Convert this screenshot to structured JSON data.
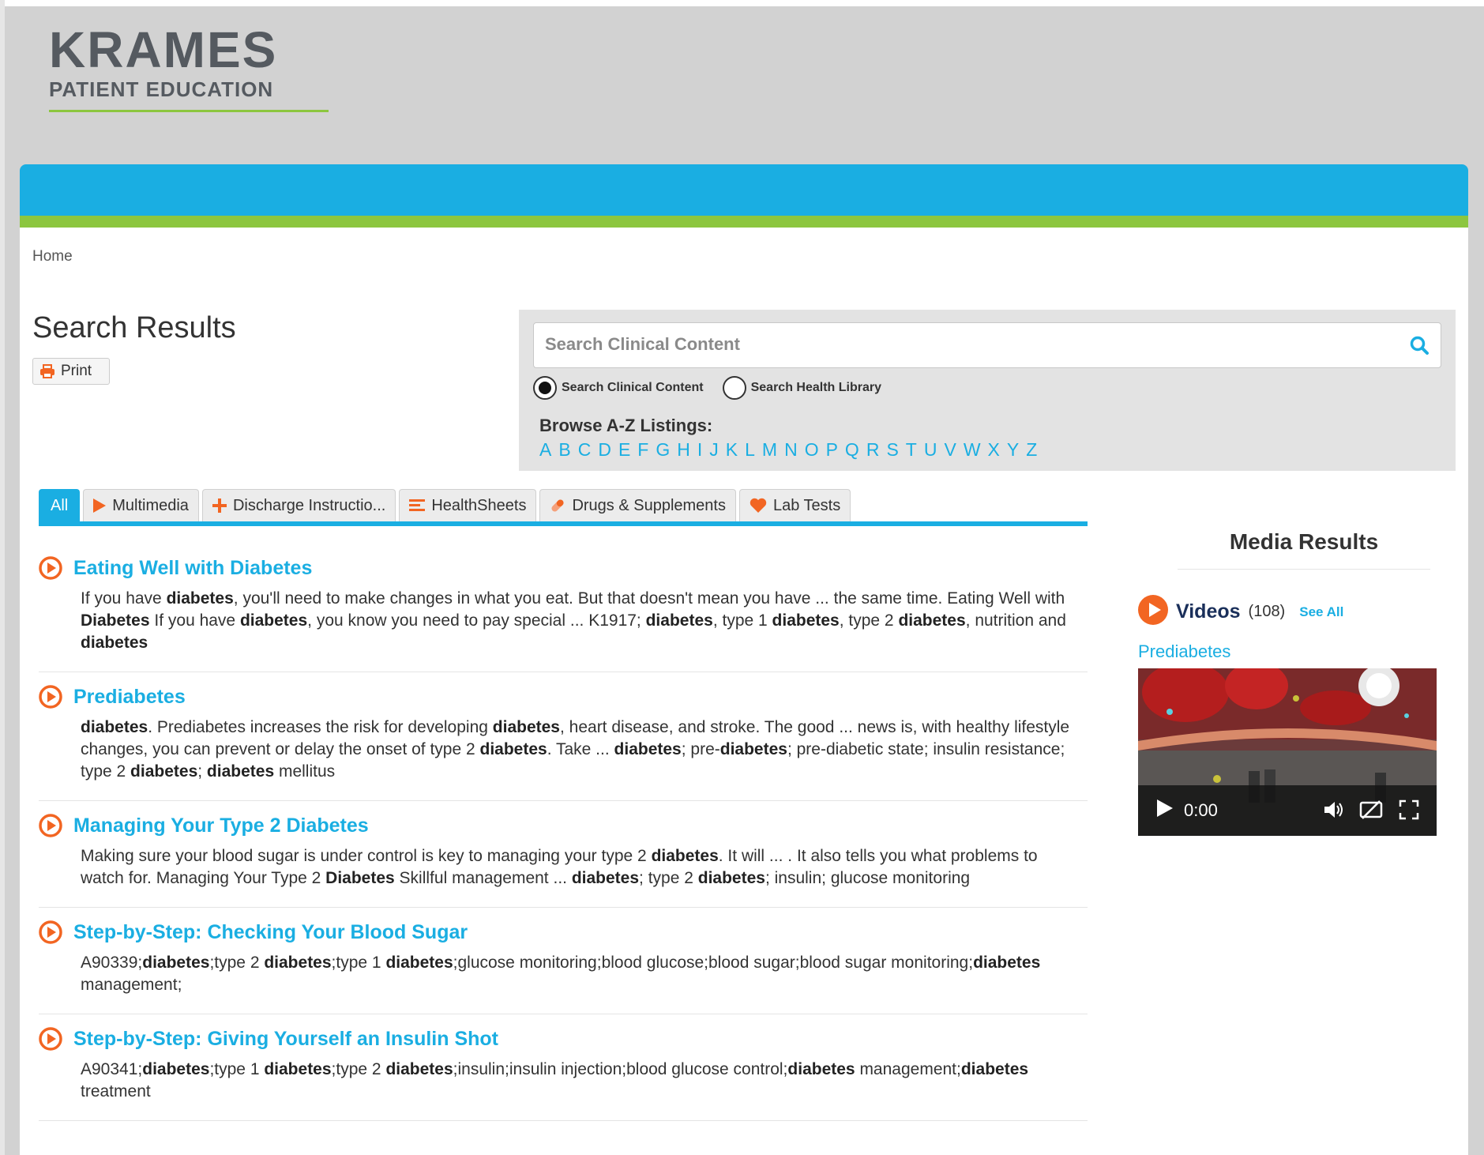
{
  "logo": {
    "brand": "KRAMES",
    "sub": "PATIENT EDUCATION"
  },
  "breadcrumb": {
    "home": "Home"
  },
  "page": {
    "title": "Search Results",
    "print_label": "Print"
  },
  "search": {
    "placeholder": "Search Clinical Content",
    "radio_clinical": "Search Clinical Content",
    "radio_health": "Search Health Library",
    "selected": "Search Clinical Content",
    "browse_label": "Browse A-Z Listings:",
    "letters": [
      "A",
      "B",
      "C",
      "D",
      "E",
      "F",
      "G",
      "H",
      "I",
      "J",
      "K",
      "L",
      "M",
      "N",
      "O",
      "P",
      "Q",
      "R",
      "S",
      "T",
      "U",
      "V",
      "W",
      "X",
      "Y",
      "Z"
    ]
  },
  "tabs": [
    {
      "label": "All",
      "icon": "none",
      "active": true
    },
    {
      "label": "Multimedia",
      "icon": "play-icon"
    },
    {
      "label": "Discharge Instructio...",
      "icon": "plus-icon"
    },
    {
      "label": "HealthSheets",
      "icon": "list-icon"
    },
    {
      "label": "Drugs & Supplements",
      "icon": "pill-icon"
    },
    {
      "label": "Lab Tests",
      "icon": "heart-icon"
    }
  ],
  "results": [
    {
      "title": "Eating Well with Diabetes",
      "snippet": [
        [
          "If you have ",
          false
        ],
        [
          "diabetes",
          true
        ],
        [
          ", you'll need to make changes in what you eat. But that doesn't mean you have ... the same time. Eating Well with ",
          false
        ],
        [
          "Diabetes",
          true
        ],
        [
          " If you have ",
          false
        ],
        [
          "diabetes",
          true
        ],
        [
          ", you know you need to pay special ... K1917; ",
          false
        ],
        [
          "diabetes",
          true
        ],
        [
          ", type 1 ",
          false
        ],
        [
          "diabetes",
          true
        ],
        [
          ", type 2 ",
          false
        ],
        [
          "diabetes",
          true
        ],
        [
          ", nutrition and ",
          false
        ],
        [
          "diabetes",
          true
        ]
      ]
    },
    {
      "title": "Prediabetes",
      "snippet": [
        [
          "diabetes",
          true
        ],
        [
          ". Prediabetes increases the risk for developing ",
          false
        ],
        [
          "diabetes",
          true
        ],
        [
          ", heart disease, and stroke. The good ... news is, with healthy lifestyle changes, you can prevent or delay the onset of type 2 ",
          false
        ],
        [
          "diabetes",
          true
        ],
        [
          ". Take ... ",
          false
        ],
        [
          "diabetes",
          true
        ],
        [
          "; pre-",
          false
        ],
        [
          "diabetes",
          true
        ],
        [
          "; pre-diabetic state; insulin resistance; type 2 ",
          false
        ],
        [
          "diabetes",
          true
        ],
        [
          "; ",
          false
        ],
        [
          "diabetes",
          true
        ],
        [
          " mellitus",
          false
        ]
      ]
    },
    {
      "title": "Managing Your Type 2 Diabetes",
      "snippet": [
        [
          "Making sure your blood sugar is under control is key to managing your type 2 ",
          false
        ],
        [
          "diabetes",
          true
        ],
        [
          ". It will ... . It also tells you what problems to watch for. Managing Your Type 2 ",
          false
        ],
        [
          "Diabetes",
          true
        ],
        [
          " Skillful management ... ",
          false
        ],
        [
          "diabetes",
          true
        ],
        [
          "; type 2 ",
          false
        ],
        [
          "diabetes",
          true
        ],
        [
          "; insulin; glucose monitoring",
          false
        ]
      ]
    },
    {
      "title": "Step-by-Step: Checking Your Blood Sugar",
      "snippet": [
        [
          "A90339;",
          false
        ],
        [
          "diabetes",
          true
        ],
        [
          ";type 2 ",
          false
        ],
        [
          "diabetes",
          true
        ],
        [
          ";type 1 ",
          false
        ],
        [
          "diabetes",
          true
        ],
        [
          ";glucose monitoring;blood glucose;blood sugar;blood sugar monitoring;",
          false
        ],
        [
          "diabetes",
          true
        ],
        [
          " management;",
          false
        ]
      ]
    },
    {
      "title": "Step-by-Step: Giving Yourself an Insulin Shot",
      "snippet": [
        [
          "A90341;",
          false
        ],
        [
          "diabetes",
          true
        ],
        [
          ";type 1 ",
          false
        ],
        [
          "diabetes",
          true
        ],
        [
          ";type 2 ",
          false
        ],
        [
          "diabetes",
          true
        ],
        [
          ";insulin;insulin injection;blood glucose control;",
          false
        ],
        [
          "diabetes",
          true
        ],
        [
          " management;",
          false
        ],
        [
          "diabetes",
          true
        ],
        [
          " treatment",
          false
        ]
      ]
    }
  ],
  "media": {
    "title": "Media Results",
    "videos_label": "Videos",
    "videos_count": "(108)",
    "see_all": "See All",
    "video_title": "Prediabetes",
    "player_time": "0:00"
  },
  "colors": {
    "accent": "#1aaee2",
    "green": "#8cc63f",
    "orange": "#f26522",
    "text": "#333333"
  }
}
